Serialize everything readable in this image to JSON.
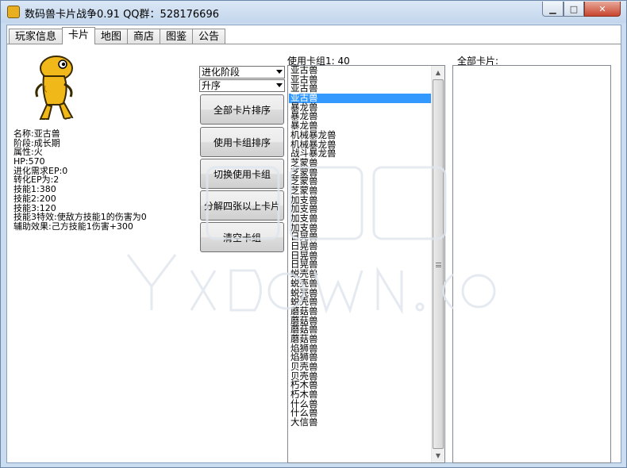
{
  "window": {
    "title": "数码兽卡片战争0.91  QQ群：528176696",
    "minimize_label": "▁",
    "maximize_label": "□",
    "close_label": "✕"
  },
  "tabs": [
    {
      "label": "玩家信息",
      "active": false
    },
    {
      "label": "卡片",
      "active": true
    },
    {
      "label": "地图",
      "active": false
    },
    {
      "label": "商店",
      "active": false
    },
    {
      "label": "图鉴",
      "active": false
    },
    {
      "label": "公告",
      "active": false
    }
  ],
  "card_info": {
    "name": "名称:亚古兽",
    "stage": "阶段:成长期",
    "attribute": "属性:火",
    "hp": "HP:570",
    "evo_ep": "进化需求EP:0",
    "convert_ep": "转化EP为:2",
    "skill1": "技能1:380",
    "skill2": "技能2:200",
    "skill3": "技能3:120",
    "skill3_effect": "技能3特效:使敌方技能1的伤害为0",
    "support": "辅助效果:己方技能1伤害+300"
  },
  "controls": {
    "sort_field_value": "进化阶段",
    "sort_order_value": "升序",
    "sort_all_button": "全部卡片排序",
    "sort_deck_button": "使用卡组排序",
    "switch_deck_button": "切换使用卡组",
    "decompose_button": "分解四张以上卡片",
    "clear_deck_button": "清空卡组"
  },
  "deck": {
    "label": "使用卡组1: 40",
    "selected_index": 3,
    "items": [
      "亚古兽",
      "亚古兽",
      "亚古兽",
      "亚古兽",
      "暴龙兽",
      "暴龙兽",
      "暴龙兽",
      "机械暴龙兽",
      "机械暴龙兽",
      "战斗暴龙兽",
      "芝蒙兽",
      "芝蒙兽",
      "芝蒙兽",
      "芝蒙兽",
      "加支兽",
      "加支兽",
      "加支兽",
      "加支兽",
      "日晃兽",
      "日晃兽",
      "日晃兽",
      "日晃兽",
      "蜕壳兽",
      "蜕壳兽",
      "蜕壳兽",
      "蜕壳兽",
      "蘑菇兽",
      "蘑菇兽",
      "蘑菇兽",
      "蘑菇兽",
      "焰狮兽",
      "焰狮兽",
      "贝壳兽",
      "贝壳兽",
      "朽木兽",
      "朽木兽",
      "什么兽",
      "什么兽",
      "大信兽"
    ]
  },
  "all_cards": {
    "label": "全部卡片:"
  },
  "colors": {
    "selection": "#3399ff",
    "window_frame": "#c9dcf0"
  },
  "icons": {
    "app": "digimon-app-icon",
    "pet": "agumon-sprite"
  }
}
